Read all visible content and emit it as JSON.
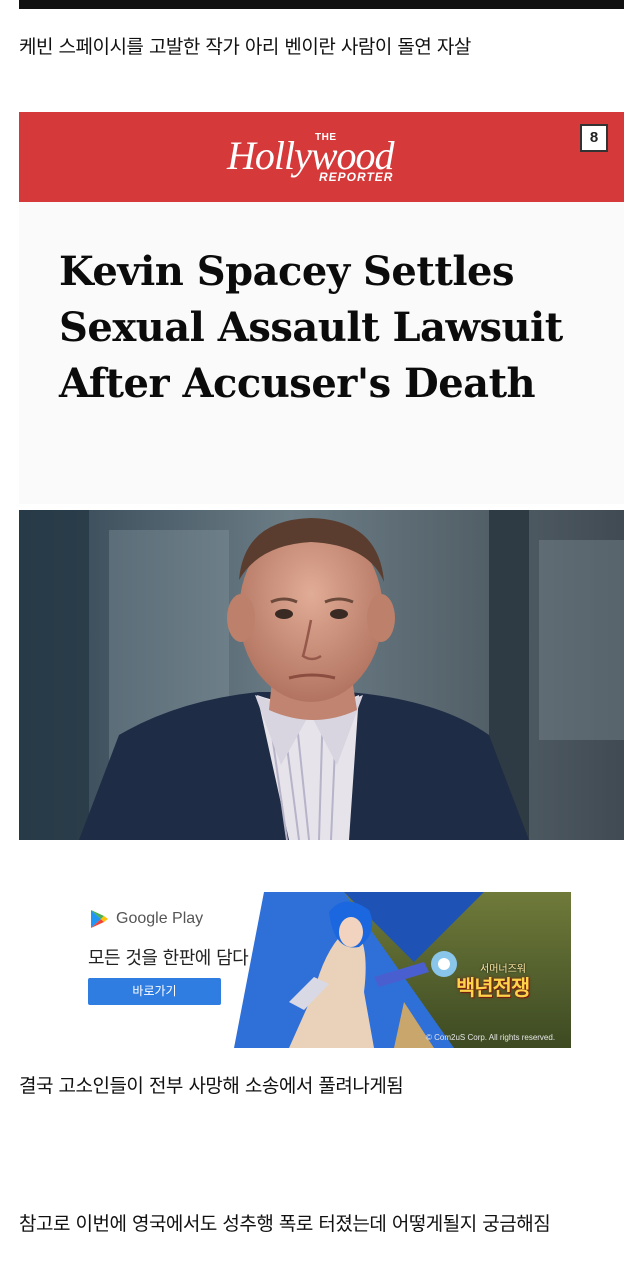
{
  "post": {
    "title_line": "케빈 스페이시를 고발한 작가 아리 벤이란 사람이 돌연 자살",
    "line_2": "결국 고소인들이 전부 사망해 소송에서 풀려나게됨",
    "line_3": "참고로 이번에 영국에서도 성추행 폭로 터졌는데 어떻게될지 궁금해짐"
  },
  "article_card": {
    "brand_the": "THE",
    "brand_script": "Hollywood",
    "brand_reporter": "REPORTER",
    "badge_number": "8",
    "headline": "Kevin Spacey Settles Sexual Assault Lawsuit After Accuser's Death",
    "banner_color": "#d6393a"
  },
  "ad": {
    "store_label": "Google Play",
    "headline": "모든 것을 한판에 담다",
    "button_label": "바로가기",
    "game_title": "백년전쟁",
    "game_subtitle": "서머너즈워",
    "copyright": "© Com2uS Corp. All rights reserved.",
    "button_color": "#2f7de1"
  }
}
